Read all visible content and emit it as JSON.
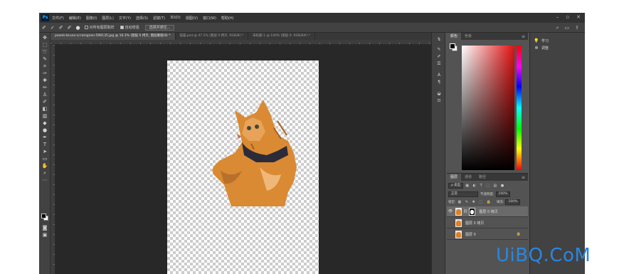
{
  "menubar": {
    "logo": "Ps",
    "items": [
      "文件(F)",
      "编辑(E)",
      "图像(I)",
      "图层(L)",
      "文字(Y)",
      "选择(S)",
      "滤镜(T)",
      "3D(D)",
      "视图(V)",
      "窗口(W)",
      "帮助(H)"
    ],
    "window_controls": [
      "–",
      "▫",
      "✕"
    ]
  },
  "options_bar": {
    "sample_all_layers_label": "对所有图层取样",
    "auto_enhance_label": "自动增强",
    "select_and_mask_label": "选择并遮住..."
  },
  "tabs": [
    {
      "label": "pexels-bruno-scramgnon-596135.jpg @ 16.3% (图层 0 拷贝, 图层蒙版/8) *"
    },
    {
      "label": "猫猫.psd @ 47.1% (图层 0 拷贝, RGB/8) *"
    },
    {
      "label": "未标题-1 @ 100% (图层 0, RGB/8#) *"
    }
  ],
  "color_panel": {
    "tabs": [
      "颜色",
      "色板"
    ]
  },
  "layers_panel": {
    "tabs": [
      "图层",
      "通道",
      "路径"
    ],
    "kind_filter": "ρ 类型",
    "blend_mode": "正常",
    "opacity_label": "不透明度:",
    "opacity_value": "100%",
    "lock_label": "锁定:",
    "fill_label": "填充:",
    "fill_value": "100%",
    "layers": [
      {
        "name": "图层 0 拷贝"
      },
      {
        "name": "图层 0 拷贝"
      },
      {
        "name": "图层 0"
      }
    ]
  },
  "right_panel": {
    "items": [
      {
        "icon": "lightbulb-icon",
        "label": "学习"
      },
      {
        "icon": "adjustments-icon",
        "label": "调整"
      }
    ]
  },
  "watermark": "UiBQ.CoM"
}
